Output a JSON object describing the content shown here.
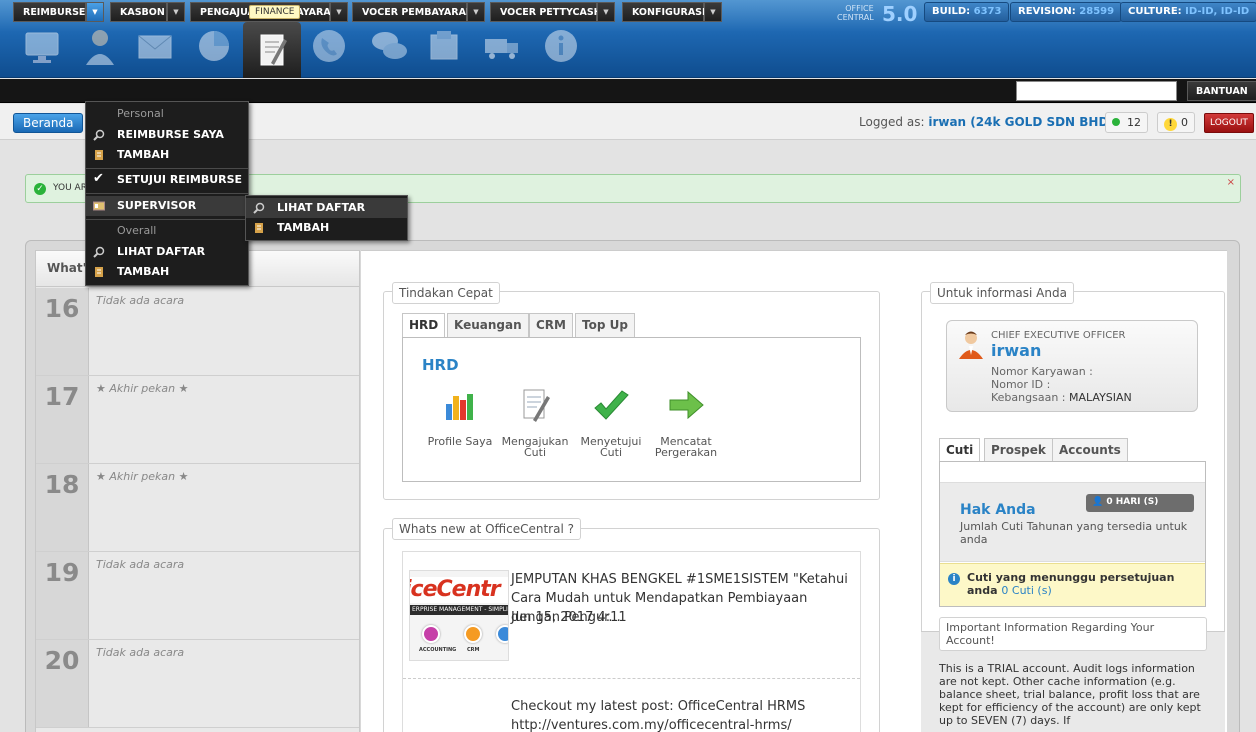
{
  "header": {
    "tooltip": "FINANCE",
    "logo_top": "OFFICE",
    "logo_bottom": "CENTRAL",
    "version": "5.0",
    "build_label": "BUILD:",
    "build_value": "6373",
    "revision_label": "REVISION:",
    "revision_value": "28599",
    "culture_label": "CULTURE:",
    "culture_value": "ID-ID, ID-ID",
    "app_icons": [
      "monitor-icon",
      "user-icon",
      "envelope-icon",
      "pie-chart-icon",
      "finance-document-icon",
      "phone-icon",
      "chat-bubbles-icon",
      "package-icon",
      "truck-icon",
      "info-icon"
    ]
  },
  "nav": {
    "items": [
      "REIMBURSE",
      "KASBON",
      "PENGAJUAN PEMBAYARAN",
      "VOCER PEMBAYARAN",
      "VOCER PETTYCASH",
      "KONFIGURASI"
    ],
    "search_value": "",
    "help_label": "BANTUAN"
  },
  "subbar": {
    "home_label": "Beranda",
    "logged_prefix": "Logged as:",
    "logged_user": "irwan (24k GOLD SDN BHD)",
    "online_count": "12",
    "warning_count": "0",
    "logout_label": "LOGOUT"
  },
  "alert": {
    "text": "YOU AR",
    "close": "×"
  },
  "dropdown": {
    "personal_header": "Personal",
    "reimburse_saya": "REIMBURSE SAYA",
    "tambah1": "TAMBAH",
    "setujui": "SETUJUI REIMBURSE",
    "supervisor": "SUPERVISOR",
    "overall_header": "Overall",
    "lihat_daftar": "LIHAT DAFTAR",
    "tambah2": "TAMBAH",
    "sub_lihat": "LIHAT DAFTAR",
    "sub_tambah": "TAMBAH"
  },
  "calendar": {
    "header": "What's",
    "days": [
      {
        "num": "16",
        "text": "Tidak ada acara"
      },
      {
        "num": "17",
        "text": "★ Akhir pekan ★"
      },
      {
        "num": "18",
        "text": "★ Akhir pekan ★"
      },
      {
        "num": "19",
        "text": "Tidak ada acara"
      },
      {
        "num": "20",
        "text": "Tidak ada acara"
      }
    ]
  },
  "quick": {
    "legend": "Tindakan Cepat",
    "tabs": [
      "HRD",
      "Keuangan",
      "CRM",
      "Top Up"
    ],
    "title": "HRD",
    "actions": [
      {
        "line1": "Profile Saya",
        "line2": ""
      },
      {
        "line1": "Mengajukan",
        "line2": "Cuti"
      },
      {
        "line1": "Menyetujui",
        "line2": "Cuti"
      },
      {
        "line1": "Mencatat",
        "line2": "Pergerakan"
      }
    ]
  },
  "news": {
    "legend": "Whats new at OfficeCentral ?",
    "thumb_brand": "iceCentr",
    "thumb_tag": "ERPRISE MANAGEMENT - SIMPLIFIED",
    "thumb_labels": [
      "ACCOUNTING",
      "CRM"
    ],
    "title": "JEMPUTAN KHAS BENGKEL #1SME1SISTEM \"Ketahui Cara Mudah untuk Mendapatkan Pembiayaan dengan Pengur...",
    "date": "Jun 15, 2017 4:11",
    "post_line1": "Checkout my latest post: OfficeCentral HRMS",
    "post_line2": "http://ventures.com.my/officecentral-hrms/"
  },
  "info": {
    "legend": "Untuk informasi Anda",
    "role": "CHIEF EXECUTIVE OFFICER",
    "name": "irwan",
    "nomor_karyawan": "Nomor Karyawan :",
    "nomor_id": "Nomor ID :",
    "kebangsaan_label": "Kebangsaan :",
    "kebangsaan_value": "MALAYSIAN",
    "tabs": [
      "Cuti",
      "Prospek",
      "Accounts"
    ],
    "hak_title": "Hak Anda",
    "hak_desc": "Jumlah Cuti Tahunan yang tersedia untuk anda",
    "hari": "0 HARI (S)",
    "pending_text": "Cuti yang menunggu persetujuan anda",
    "pending_link": "0 Cuti (s)",
    "important_legend": "Important Information Regarding Your Account!",
    "important_text": "This is a TRIAL account. Audit logs information are not kept. Other cache information (e.g. balance sheet, trial balance, profit loss that are kept for efficiency of the account) are only kept up to SEVEN (7) days. If"
  }
}
